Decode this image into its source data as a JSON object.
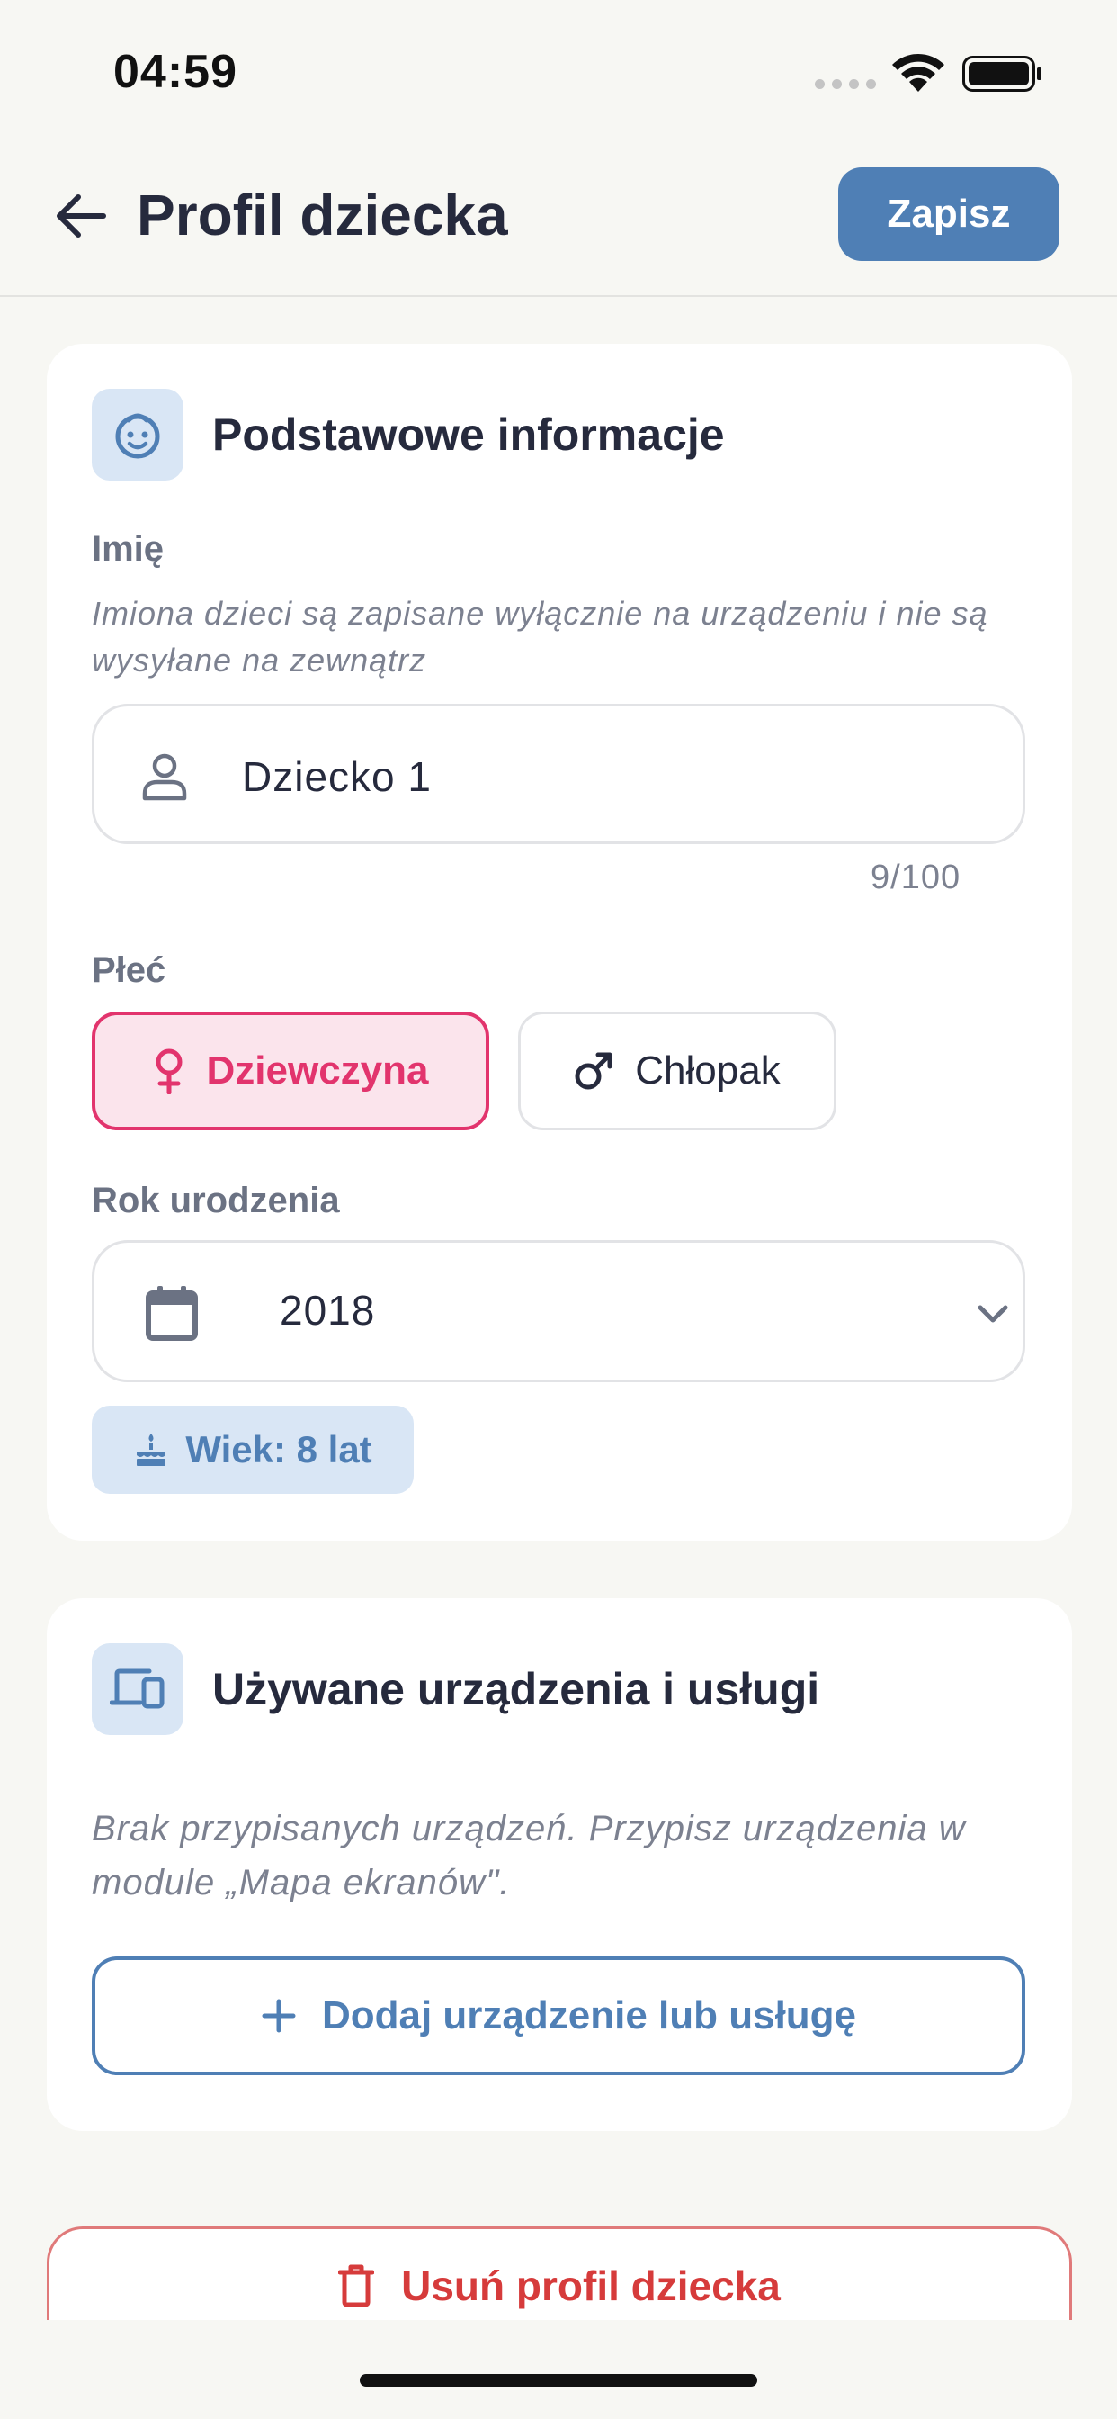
{
  "status_bar": {
    "time": "04:59"
  },
  "header": {
    "title": "Profil dziecka",
    "save_label": "Zapisz"
  },
  "basic_info": {
    "title": "Podstawowe informacje",
    "name_label": "Imię",
    "name_hint": "Imiona dzieci są zapisane wyłącznie na urządzeniu i nie są wysyłane na zewnątrz",
    "name_value": "Dziecko 1",
    "name_counter": "9/100",
    "gender_label": "Płeć",
    "gender_options": [
      "Dziewczyna",
      "Chłopak"
    ],
    "gender_selected": "Dziewczyna",
    "birth_year_label": "Rok urodzenia",
    "birth_year_value": "2018",
    "age_badge": "Wiek: 8 lat"
  },
  "devices": {
    "title": "Używane urządzenia i usługi",
    "empty_text": "Brak przypisanych urządzeń. Przypisz urządzenia w module „Mapa ekranów\".",
    "add_label": "Dodaj urządzenie lub usługę"
  },
  "delete_label": "Usuń profil dziecka",
  "colors": {
    "accent": "#4f7fb5",
    "accent_light": "#d9e6f5",
    "girl": "#e2346d",
    "girl_bg": "#fbe4ec",
    "danger": "#d63b3b",
    "background": "#f7f7f3"
  }
}
